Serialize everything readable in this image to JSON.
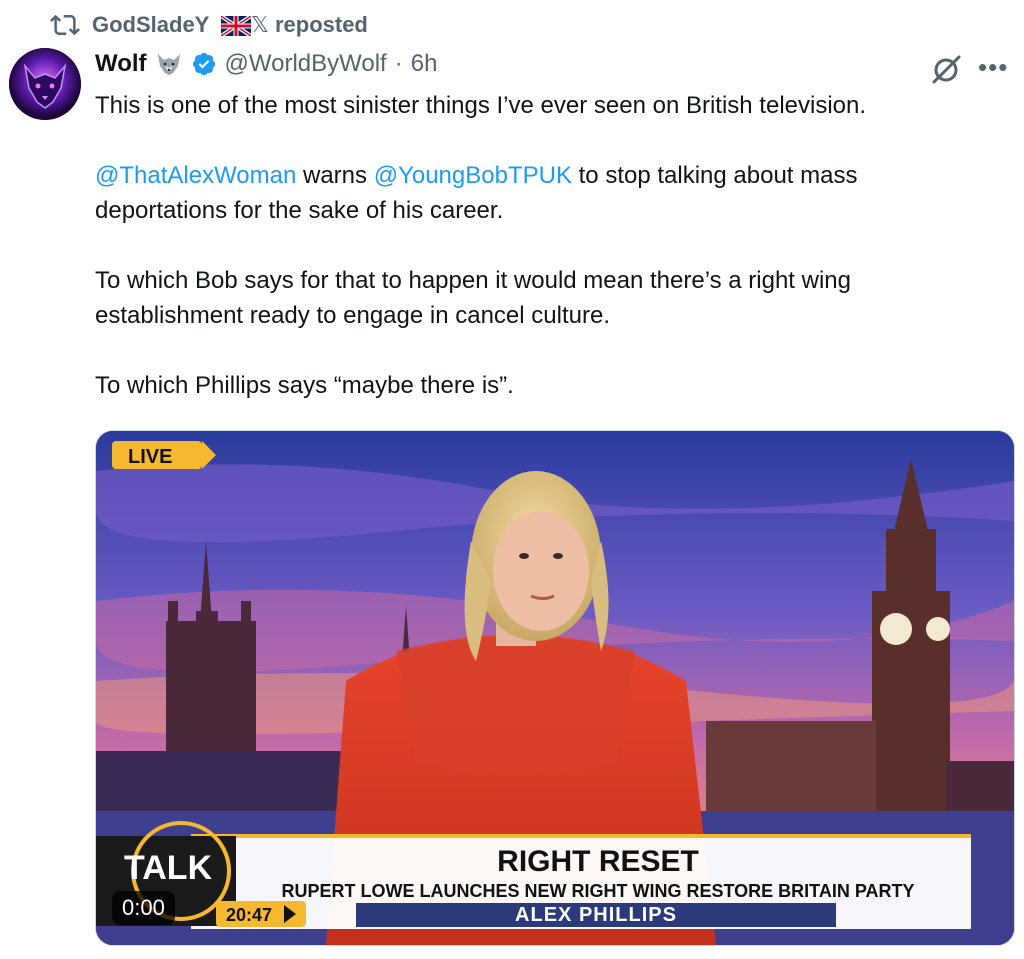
{
  "repost": {
    "user": "GodSladeY",
    "flag_icon": "uk-flag-icon",
    "x_mark": "𝕏",
    "label": "reposted"
  },
  "tweet": {
    "name": "Wolf",
    "handle": "@WorldByWolf",
    "dot": "·",
    "time": "6h",
    "para1": "This is one of the most sinister things I’ve ever seen on British television.",
    "mention1": "@ThatAlexWoman",
    "warns": " warns ",
    "mention2": "@YoungBobTPUK",
    "para2_rest": " to stop talking about mass deportations for the sake of his career.",
    "para3": "To which Bob says for that to happen it would mean there’s a right wing establishment ready to engage in cancel culture.",
    "para4": "To which Phillips says “maybe there is”."
  },
  "video": {
    "live_label": "LIVE",
    "channel": "TALK",
    "clock": "20:47",
    "headline": "RIGHT RESET",
    "subheadline": "RUPERT LOWE LAUNCHES NEW RIGHT WING RESTORE BRITAIN PARTY",
    "presenter": "ALEX PHILLIPS",
    "duration": "0:00"
  },
  "colors": {
    "mention": "#1d9bf0",
    "secondary_text": "#536471",
    "verified": "#1d9bf0",
    "live_badge": "#f5b82e"
  }
}
